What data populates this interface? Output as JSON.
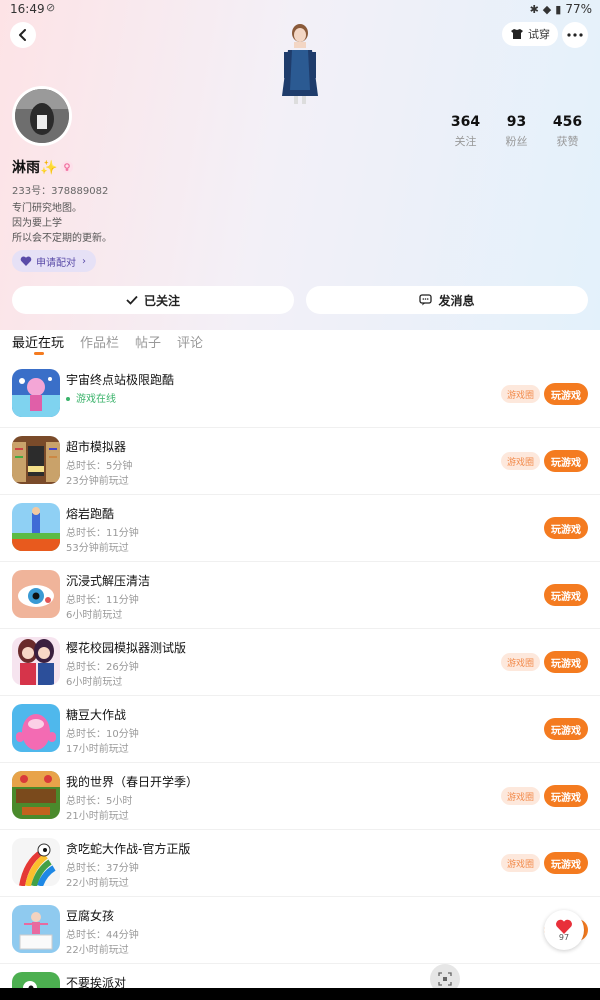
{
  "status": {
    "time": "16:49",
    "battery": "77%"
  },
  "header": {
    "try_on_label": "试穿"
  },
  "profile": {
    "name": "淋雨✨",
    "uid_text": "233号：378889082",
    "bio": [
      "专门研究地图。",
      "因为要上学",
      "所以会不定期的更新。"
    ],
    "pair_label": "申请配对",
    "stats": [
      {
        "value": "364",
        "label": "关注"
      },
      {
        "value": "93",
        "label": "粉丝"
      },
      {
        "value": "456",
        "label": "获赞"
      }
    ]
  },
  "actions": {
    "follow_label": "已关注",
    "message_label": "发消息"
  },
  "tabs": [
    "最近在玩",
    "作品栏",
    "帖子",
    "评论"
  ],
  "buttons": {
    "circle": "游戏圈",
    "play": "玩游戏"
  },
  "games": [
    {
      "name": "宇宙终点站极限跑酷",
      "sub1": "游戏在线",
      "sub2": "",
      "online": true,
      "circle": true
    },
    {
      "name": "超市模拟器",
      "sub1": "总时长：5分钟",
      "sub2": "23分钟前玩过",
      "online": false,
      "circle": true
    },
    {
      "name": "熔岩跑酷",
      "sub1": "总时长：11分钟",
      "sub2": "53分钟前玩过",
      "online": false,
      "circle": false
    },
    {
      "name": "沉浸式解压清洁",
      "sub1": "总时长：11分钟",
      "sub2": "6小时前玩过",
      "online": false,
      "circle": false
    },
    {
      "name": "樱花校园模拟器测试版",
      "sub1": "总时长：26分钟",
      "sub2": "6小时前玩过",
      "online": false,
      "circle": true
    },
    {
      "name": "糖豆大作战",
      "sub1": "总时长：10分钟",
      "sub2": "17小时前玩过",
      "online": false,
      "circle": false
    },
    {
      "name": "我的世界（春日开学季）",
      "sub1": "总时长：5小时",
      "sub2": "21小时前玩过",
      "online": false,
      "circle": true
    },
    {
      "name": "贪吃蛇大作战-官方正版",
      "sub1": "总时长：37分钟",
      "sub2": "22小时前玩过",
      "online": false,
      "circle": true
    },
    {
      "name": "豆腐女孩",
      "sub1": "总时长：44分钟",
      "sub2": "22小时前玩过",
      "online": false,
      "circle": false
    },
    {
      "name": "不要挨派对",
      "sub1": "",
      "sub2": "",
      "online": false,
      "circle": false
    }
  ],
  "fab": {
    "like_count": "97"
  }
}
